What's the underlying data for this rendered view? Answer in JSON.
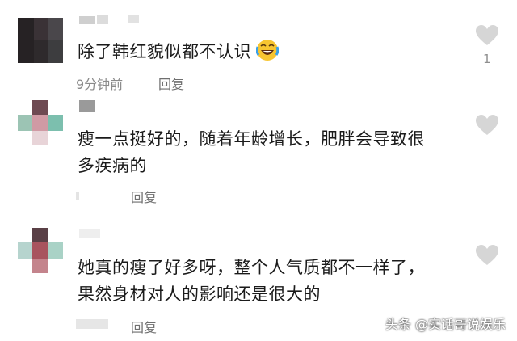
{
  "comments": [
    {
      "text": "除了韩红貌似都不认识",
      "time": "9分钟前",
      "reply": "回复",
      "likes": "1",
      "emoji": "laughing-crying-emoji"
    },
    {
      "text_line1": "瘦一点挺好的，随着年龄增长，肥胖会导致很",
      "text_line2": "多疾病的",
      "reply": "回复"
    },
    {
      "text_line1": "她真的瘦了好多呀，整个人气质都不一样了，",
      "text_line2": "果然身材对人的影响还是很大的",
      "reply": "回复"
    }
  ],
  "icons": {
    "like": "heart-icon"
  },
  "colors": {
    "heart": "#d6d6d6",
    "text": "#1b1b1b",
    "meta": "#8a8a8a"
  },
  "watermark": "头条 @实话哥说娱乐"
}
